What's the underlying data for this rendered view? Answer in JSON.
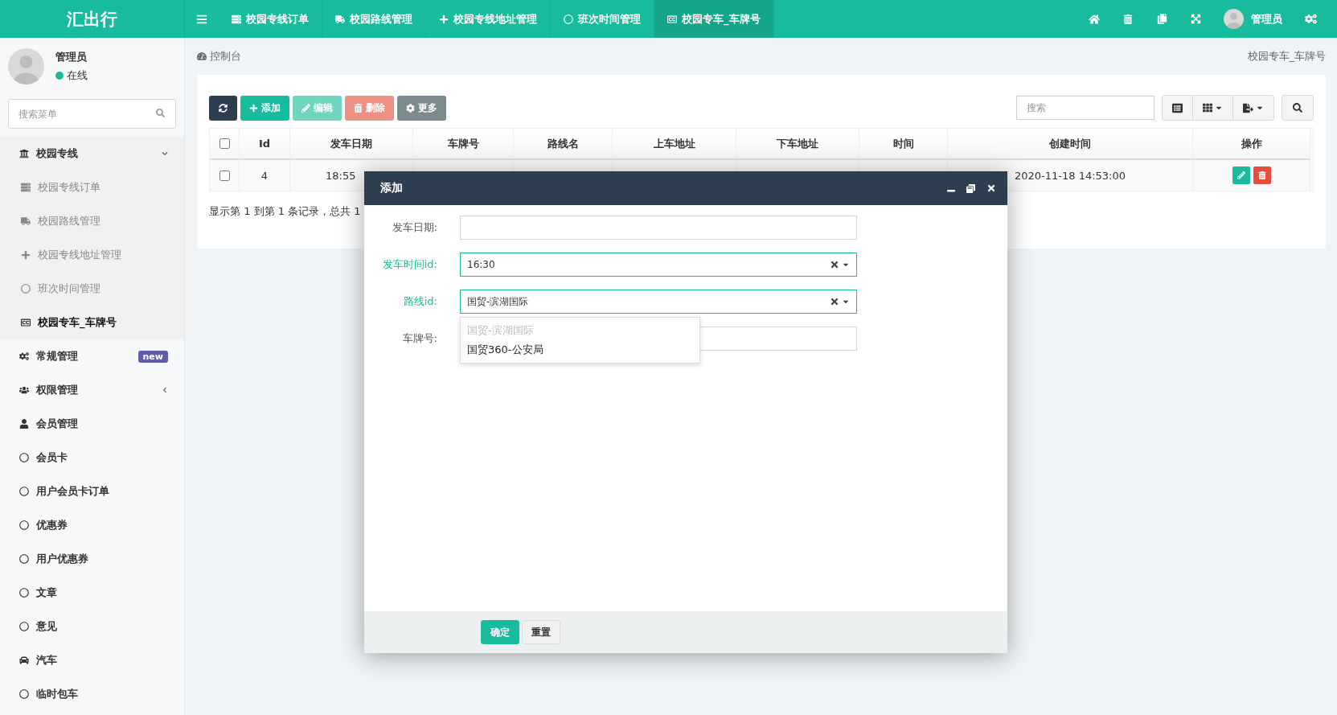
{
  "header": {
    "logo": "汇出行",
    "tabs": [
      {
        "label": "校园专线订单",
        "selected": false
      },
      {
        "label": "校园路线管理",
        "selected": false
      },
      {
        "label": "校园专线地址管理",
        "selected": false
      },
      {
        "label": "班次时间管理",
        "selected": false
      },
      {
        "label": "校园专车_车牌号",
        "selected": true
      }
    ],
    "user": "管理员"
  },
  "sidebar": {
    "user": {
      "name": "管理员",
      "status": "在线",
      "online": true
    },
    "search": {
      "placeholder": "搜索菜单"
    },
    "menu": [
      {
        "label": "校园专线",
        "selected": false,
        "expanded": true,
        "children": [
          {
            "label": "校园专线订单",
            "selected": false
          },
          {
            "label": "校园路线管理",
            "selected": false
          },
          {
            "label": "校园专线地址管理",
            "selected": false
          },
          {
            "label": "班次时间管理",
            "selected": false
          },
          {
            "label": "校园专车_车牌号",
            "selected": true
          }
        ]
      },
      {
        "label": "常规管理",
        "selected": false,
        "badge": "new"
      },
      {
        "label": "权限管理",
        "selected": false,
        "expanded": false
      },
      {
        "label": "会员管理",
        "selected": false
      },
      {
        "label": "会员卡",
        "selected": false
      },
      {
        "label": "用户会员卡订单",
        "selected": false
      },
      {
        "label": "优惠券",
        "selected": false
      },
      {
        "label": "用户优惠券",
        "selected": false
      },
      {
        "label": "文章",
        "selected": false
      },
      {
        "label": "意见",
        "selected": false
      },
      {
        "label": "汽车",
        "selected": false
      },
      {
        "label": "临时包车",
        "selected": false
      }
    ]
  },
  "breadcrumb": {
    "home": "控制台",
    "current": "校园专车_车牌号"
  },
  "toolbar": {
    "buttons": [
      {
        "kind": "refresh",
        "disabled": false
      },
      {
        "kind": "add",
        "label": "添加",
        "disabled": false
      },
      {
        "kind": "edit",
        "label": "编辑",
        "disabled": true
      },
      {
        "kind": "delete",
        "label": "删除",
        "disabled": true
      },
      {
        "kind": "more",
        "label": "更多",
        "disabled": false
      }
    ],
    "search": {
      "placeholder": "搜索"
    }
  },
  "table": {
    "all_checked": false,
    "columns": [
      "Id",
      "发车日期",
      "车牌号",
      "路线名",
      "上车地址",
      "下车地址",
      "时间",
      "创建时间",
      "操作"
    ],
    "rows": [
      {
        "checked": false,
        "id": "4",
        "date": "18:55",
        "created": "2020-11-18 14:53:00"
      }
    ],
    "pagination": "显示第 1 到第 1 条记录，总共 1"
  },
  "dialog": {
    "title": "添加",
    "fields": [
      {
        "kind": "text",
        "label": "发车日期:",
        "highlighted": false
      },
      {
        "kind": "select",
        "label": "发车时间id:",
        "value": "16:30",
        "highlighted": true,
        "open": false
      },
      {
        "kind": "select",
        "label": "路线id:",
        "value": "国贸-滨湖国际",
        "highlighted": true,
        "open": true
      },
      {
        "kind": "text",
        "label": "车牌号:",
        "highlighted": false
      }
    ],
    "options": [
      {
        "label": "国贸-滨湖国际",
        "disabled": true
      },
      {
        "label": "国贸360-公安局",
        "disabled": false
      }
    ],
    "buttons": [
      {
        "kind": "primary",
        "label": "确定"
      },
      {
        "kind": "default",
        "label": "重置"
      }
    ]
  }
}
